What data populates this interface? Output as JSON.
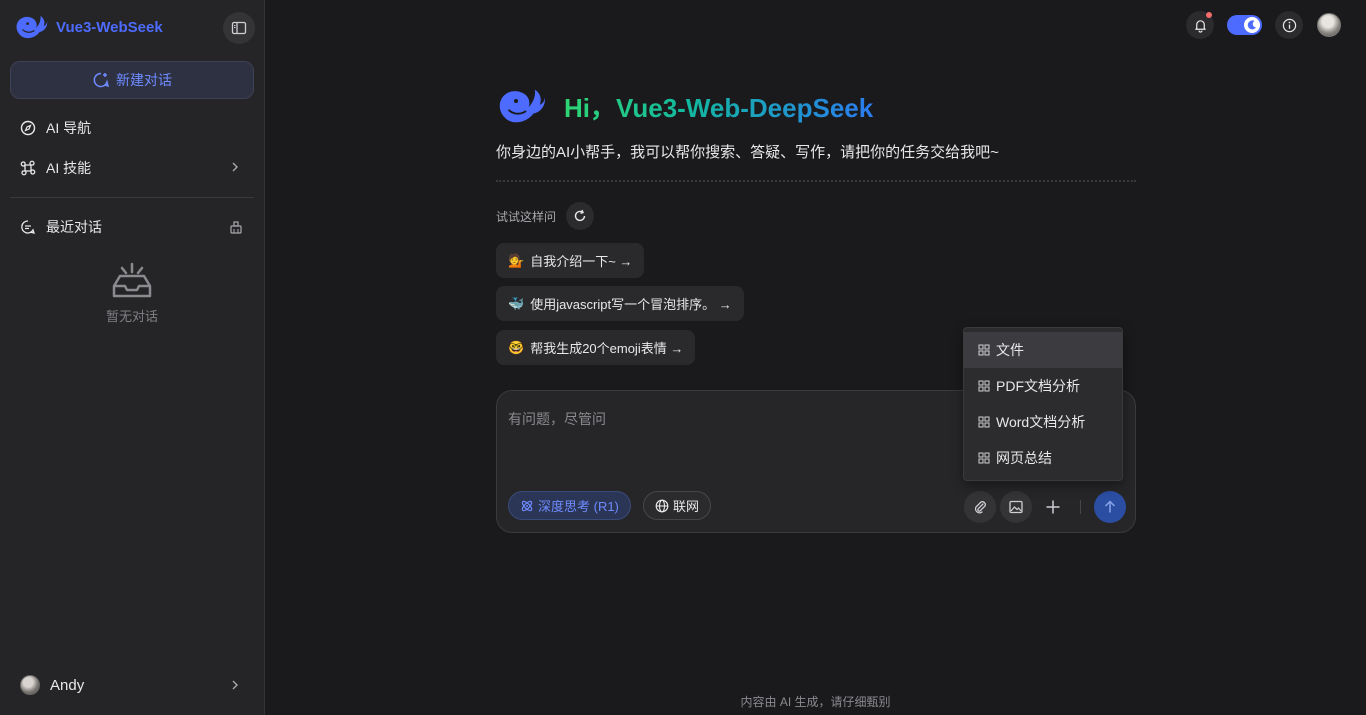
{
  "sidebar": {
    "brand": "Vue3-WebSeek",
    "new_chat": "新建对话",
    "nav": [
      {
        "label": "AI 导航",
        "icon": "compass-icon"
      },
      {
        "label": "AI 技能",
        "icon": "command-icon"
      }
    ],
    "recent_label": "最近对话",
    "empty_label": "暂无对话",
    "user_name": "Andy"
  },
  "colors": {
    "accent": "#4d6bfe",
    "background": "#1a1a1c",
    "sidebar": "#252527"
  },
  "main": {
    "title": "Hi，Vue3-Web-DeepSeek",
    "subtitle": "你身边的AI小帮手，我可以帮你搜索、答疑、写作，请把你的任务交给我吧~",
    "try_label": "试试这样问",
    "suggestions": [
      {
        "emoji": "💁",
        "text": "自我介绍一下~ →"
      },
      {
        "emoji": "🐳",
        "text": "使用javascript写一个冒泡排序。 →"
      },
      {
        "emoji": "🤓",
        "text": "帮我生成20个emoji表情 →"
      }
    ],
    "input_placeholder": "有问题，尽管问",
    "deep_think": "深度思考 (R1)",
    "web_search": "联网"
  },
  "dropdown": {
    "items": [
      "文件",
      "PDF文档分析",
      "Word文档分析",
      "网页总结"
    ]
  },
  "footer": "内容由 AI 生成，请仔细甄别"
}
